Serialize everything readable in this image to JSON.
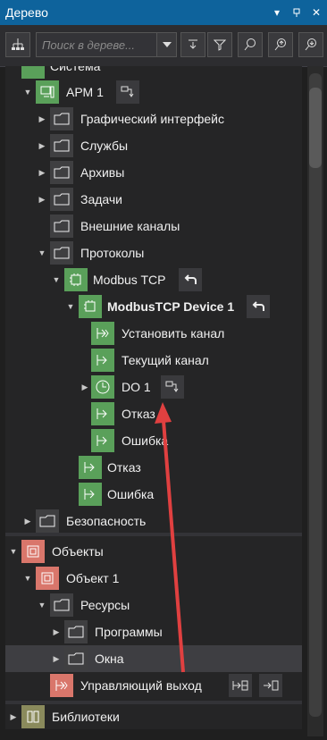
{
  "window": {
    "title": "Дерево",
    "pin": "▾",
    "close": "✕"
  },
  "toolbar": {
    "search_placeholder": "Поиск в дереве..."
  },
  "tree": {
    "system_partial": "Система",
    "arm": {
      "label": "АРМ 1"
    },
    "folders": [
      "Графический интерфейс",
      "Службы",
      "Архивы",
      "Задачи",
      "Внешние каналы",
      "Протоколы"
    ],
    "modbus": {
      "label": "Modbus TCP"
    },
    "device": {
      "label": "ModbusTCP Device 1"
    },
    "device_children": [
      "Установить канал",
      "Текущий канал",
      "DO 1",
      "Отказ",
      "Ошибка"
    ],
    "modbus_children": [
      "Отказ",
      "Ошибка"
    ],
    "security": "Безопасность"
  },
  "objects": {
    "root": "Объекты",
    "object1": "Объект 1",
    "resources": "Ресурсы",
    "programs": "Программы",
    "windows": "Окна",
    "control_output": "Управляющий выход"
  },
  "libraries": {
    "label": "Библиотеки"
  },
  "colors": {
    "title_bar": "#0e639c",
    "green_icon": "#5aa05a",
    "red_icon": "#d9766b",
    "annotation": "#e04040"
  }
}
